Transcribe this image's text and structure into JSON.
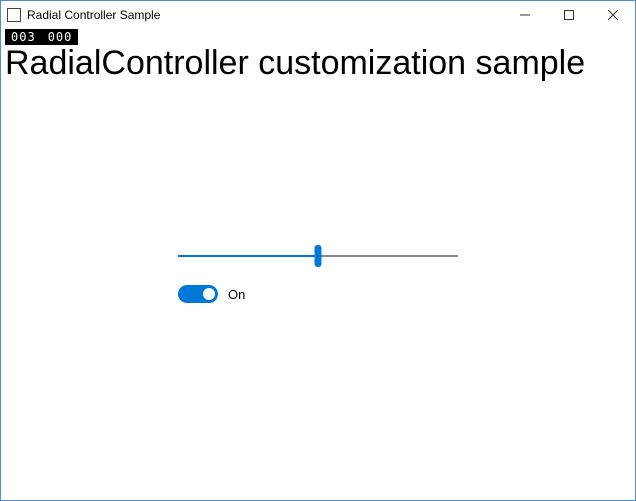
{
  "window": {
    "title": "Radial Controller Sample"
  },
  "debug": {
    "counter1": "003",
    "counter2": "000"
  },
  "page": {
    "heading": "RadialController customization sample"
  },
  "slider": {
    "value": 50,
    "min": 0,
    "max": 100
  },
  "toggle": {
    "state": true,
    "label": "On"
  },
  "colors": {
    "accent": "#0078d7"
  }
}
